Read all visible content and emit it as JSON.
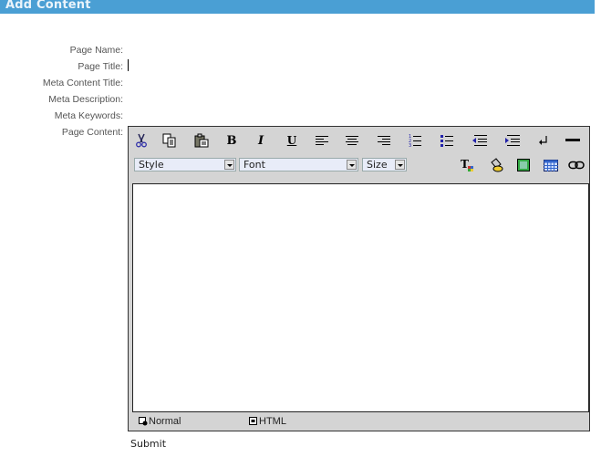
{
  "header": {
    "title": "Add Content",
    "color": "#4a9fd4"
  },
  "form": {
    "fields": [
      {
        "label": "Page Name:",
        "value": ""
      },
      {
        "label": "Page Title:",
        "value": ""
      },
      {
        "label": "Meta Content Title:",
        "value": ""
      },
      {
        "label": "Meta Description:",
        "value": ""
      },
      {
        "label": "Meta Keywords:",
        "value": ""
      },
      {
        "label": "Page Content:"
      }
    ]
  },
  "editor": {
    "toolbar_row1": [
      "cut-icon",
      "copy-icon",
      "paste-icon",
      "bold-icon",
      "italic-icon",
      "underline-icon",
      "align-left-icon",
      "align-center-icon",
      "align-right-icon",
      "ordered-list-icon",
      "unordered-list-icon",
      "outdent-icon",
      "indent-icon",
      "line-break-icon",
      "horizontal-rule-icon"
    ],
    "selects": {
      "style": "Style",
      "font": "Font",
      "size": "Size"
    },
    "toolbar_row2": [
      "text-color-icon",
      "background-color-icon",
      "insert-image-icon",
      "insert-table-icon",
      "insert-link-icon"
    ],
    "content": "",
    "modes": {
      "normal": "Normal",
      "html": "HTML"
    }
  },
  "submit_label": "Submit"
}
